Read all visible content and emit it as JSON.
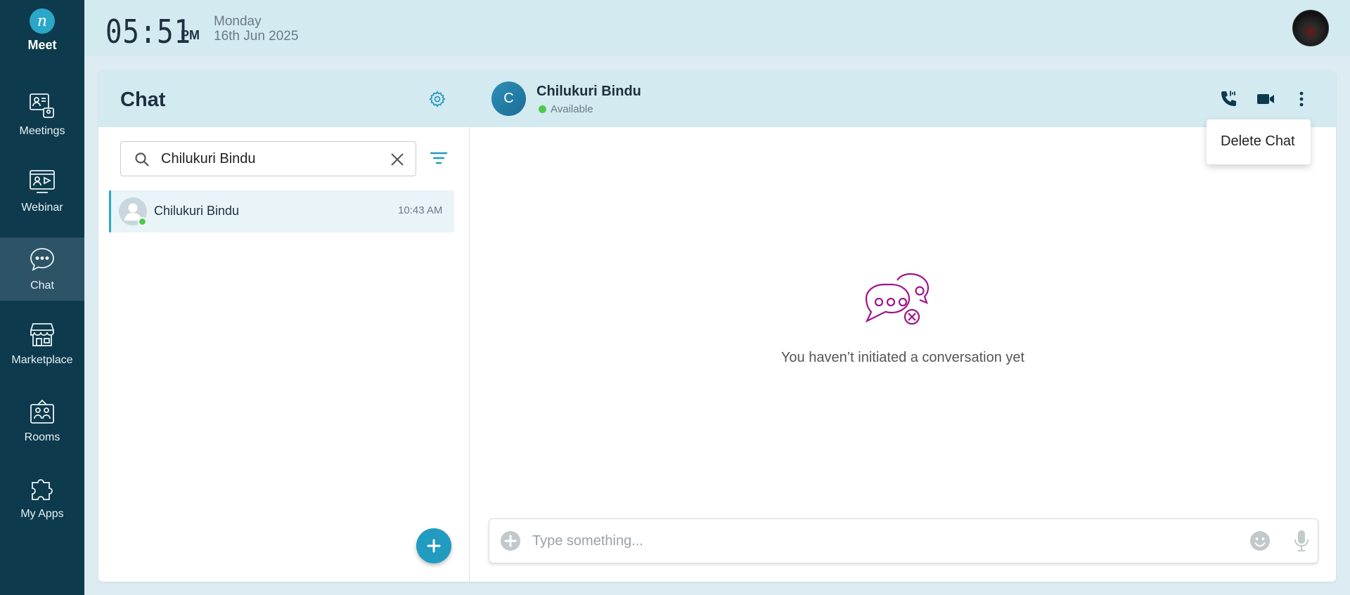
{
  "app": {
    "logo_text": "Meet",
    "logo_glyph": "n"
  },
  "sidebar": {
    "items": [
      {
        "label": "Meetings",
        "icon": "meetings-icon",
        "active": false
      },
      {
        "label": "Webinar",
        "icon": "webinar-icon",
        "active": false
      },
      {
        "label": "Chat",
        "icon": "chat-icon",
        "active": true
      },
      {
        "label": "Marketplace",
        "icon": "marketplace-icon",
        "active": false
      },
      {
        "label": "Rooms",
        "icon": "rooms-icon",
        "active": false
      },
      {
        "label": "My Apps",
        "icon": "puzzle-icon",
        "active": false
      }
    ]
  },
  "header": {
    "time": "05:51",
    "ampm": "PM",
    "day": "Monday",
    "date": "16th Jun 2025"
  },
  "chat_list": {
    "title": "Chat",
    "search_value": "Chilukuri Bindu",
    "contacts": [
      {
        "name": "Chilukuri Bindu",
        "time": "10:43 AM",
        "online": true
      }
    ]
  },
  "conversation": {
    "avatar_initial": "C",
    "name": "Chilukuri Bindu",
    "status": "Available",
    "menu": {
      "items": [
        "Delete Chat"
      ]
    },
    "empty_message": "You haven’t initiated a conversation yet",
    "composer_placeholder": "Type something..."
  },
  "colors": {
    "sidebar_bg": "#0d3a4c",
    "accent": "#229bc0",
    "online": "#4cc94c",
    "empty_icon": "#a0148c"
  }
}
